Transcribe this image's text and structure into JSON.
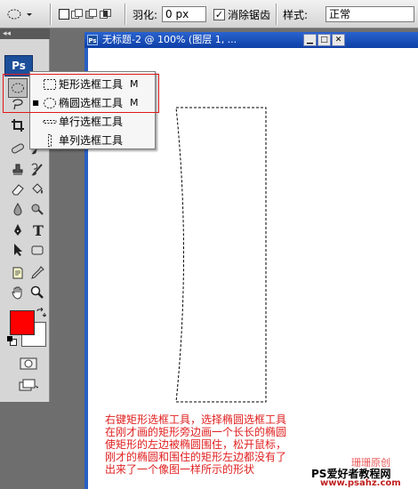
{
  "options_bar": {
    "feather_label": "羽化:",
    "feather_value": "0 px",
    "antialias_label": "消除锯齿",
    "antialias_checked": "✓",
    "style_label": "样式:",
    "style_value": "正常"
  },
  "toolbox": {
    "collapse_glyph": "◂◂",
    "logo": "Ps"
  },
  "flyout": {
    "items": [
      {
        "label": "矩形选框工具",
        "shortcut": "M",
        "selected": ""
      },
      {
        "label": "椭圆选框工具",
        "shortcut": "M",
        "selected": "■"
      },
      {
        "label": "单行选框工具",
        "shortcut": "",
        "selected": ""
      },
      {
        "label": "单列选框工具",
        "shortcut": "",
        "selected": ""
      }
    ]
  },
  "document": {
    "title": "无标题-2 @ 100% (图层 1, ...",
    "icon_text": "Ps"
  },
  "caption": {
    "lines": [
      "右键矩形选框工具，选择椭圆选框工具",
      "在刚才画的矩形旁边画一个长长的椭圆",
      "使矩形的左边被椭圆围住，松开鼠标，",
      "刚才的椭圆和围住的矩形左边都没有了",
      "出来了一个像图一样所示的形状"
    ]
  },
  "watermark": {
    "faint": "珊珊原创",
    "main": "PS爱好者教程网",
    "url": "www.psahz.com"
  },
  "colors": {
    "foreground": "#ff0000",
    "background": "#ffffff",
    "annotation": "#e02020"
  }
}
